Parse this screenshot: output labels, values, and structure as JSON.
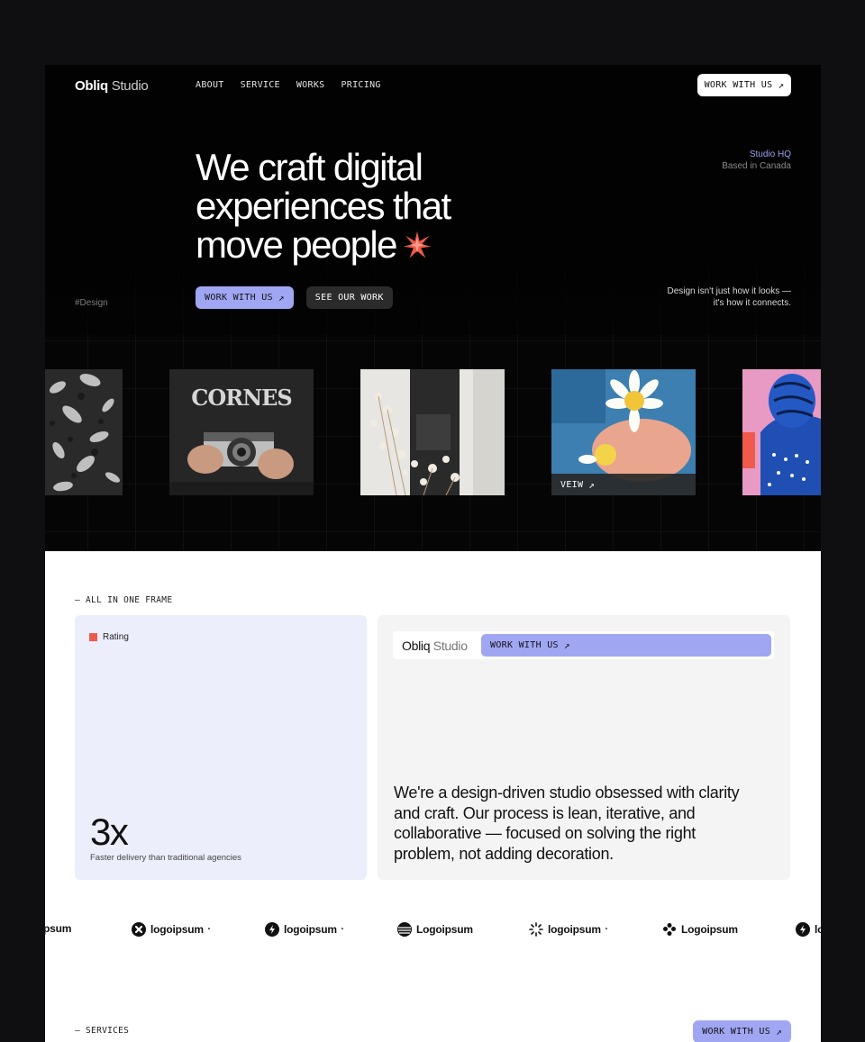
{
  "nav": {
    "logo_bold": "Obliq",
    "logo_light": "Studio",
    "links": [
      "ABOUT",
      "SERVICE",
      "WORKS",
      "PRICING"
    ],
    "cta_label": "WORK WITH US",
    "cta_icon": "arrow-up-right-icon"
  },
  "hero": {
    "headline_line1": "We craft digital",
    "headline_line2": "experiences that",
    "headline_line3": "move people",
    "accent_star_color": "#f05a4a",
    "hq_title": "Studio HQ",
    "hq_location": "Based in Canada",
    "primary_cta": "WORK WITH US",
    "secondary_cta": "SEE OUR WORK",
    "tag": "#Design",
    "quote_line1": "Design isn't just how it looks —",
    "quote_line2": "it's how it connects."
  },
  "gallery": {
    "view_label": "VEIW"
  },
  "frame_section": {
    "label": "— ALL IN ONE FRAME",
    "rating_label": "Rating",
    "stat_value": "3x",
    "stat_caption": "Faster delivery than traditional agencies",
    "mini_logo_bold": "Obliq",
    "mini_logo_light": "Studio",
    "mini_cta": "WORK WITH US",
    "about_text": "We're a design-driven studio obsessed with clarity and craft. Our process is lean, iterative, and collaborative — focused on solving the right problem, not adding decoration."
  },
  "logos": {
    "partial_left": "psum",
    "items": [
      "logoipsum",
      "logoipsum",
      "Logoipsum",
      "logoipsum",
      "Logoipsum"
    ],
    "partial_right": "lo"
  },
  "services": {
    "label": "— SERVICES",
    "cta": "WORK WITH US"
  },
  "colors": {
    "accent": "#a1a6f3",
    "hero_bg": "#050505",
    "card_lavender": "#eceefb",
    "rating_red": "#ef5a4e"
  }
}
